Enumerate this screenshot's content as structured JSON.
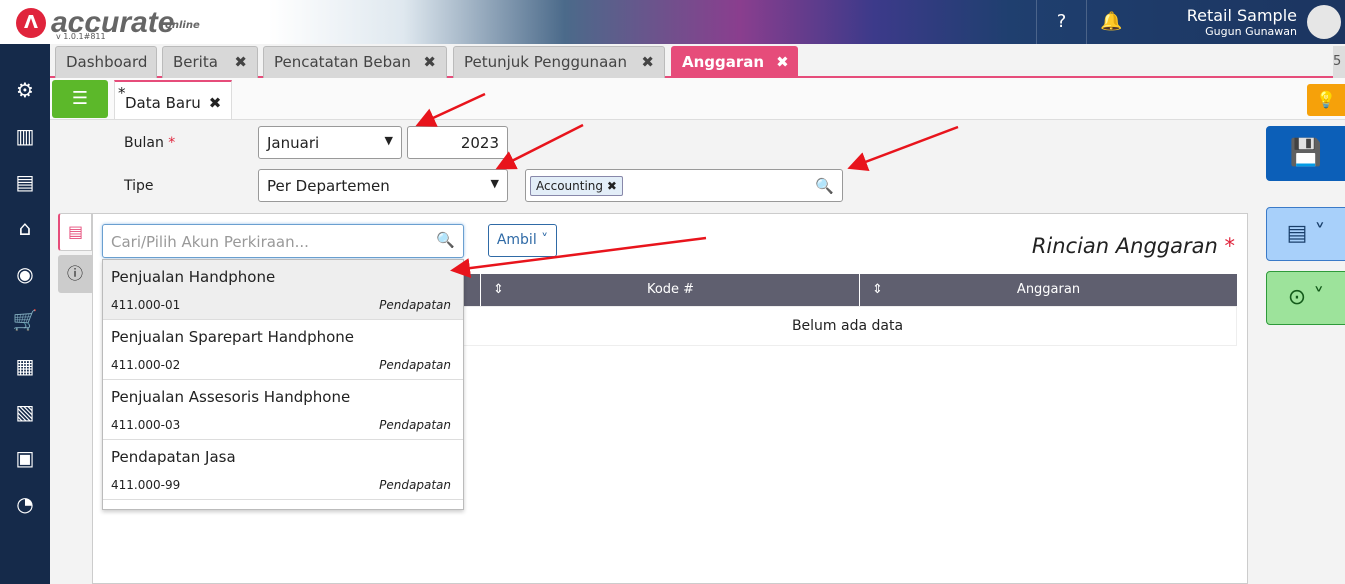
{
  "app": {
    "logo": "accurate",
    "logo_sub": "online",
    "version": "v 1.0.1#811",
    "company": "Retail Sample",
    "user": "Gugun Gunawan"
  },
  "tabs": [
    {
      "label": "Dashboard"
    },
    {
      "label": "Berita"
    },
    {
      "label": "Pencatatan Beban"
    },
    {
      "label": "Petunjuk Penggunaan"
    },
    {
      "label": "Anggaran"
    }
  ],
  "tab_overflow": "5",
  "subtab": {
    "label": "Data Baru",
    "modified": "*"
  },
  "form": {
    "bulan_label": "Bulan",
    "required": "*",
    "bulan_value": "Januari",
    "year": "2023",
    "tipe_label": "Tipe",
    "tipe_value": "Per Departemen",
    "department_chip": "Accounting"
  },
  "detail": {
    "search_placeholder": "Cari/Pilih Akun Perkiraan...",
    "ambil": "Ambil",
    "title": "Rincian Anggaran",
    "columns": [
      "Kode #",
      "Anggaran"
    ],
    "empty": "Belum ada data"
  },
  "dropdown": [
    {
      "name": "Penjualan Handphone",
      "code": "411.000-01",
      "type": "Pendapatan"
    },
    {
      "name": "Penjualan Sparepart Handphone",
      "code": "411.000-02",
      "type": "Pendapatan"
    },
    {
      "name": "Penjualan Assesoris Handphone",
      "code": "411.000-03",
      "type": "Pendapatan"
    },
    {
      "name": "Pendapatan Jasa",
      "code": "411.000-99",
      "type": "Pendapatan"
    }
  ],
  "colors": {
    "accent": "#e64c7a",
    "save": "#0c5fb8",
    "annotation": "#e8141c"
  }
}
